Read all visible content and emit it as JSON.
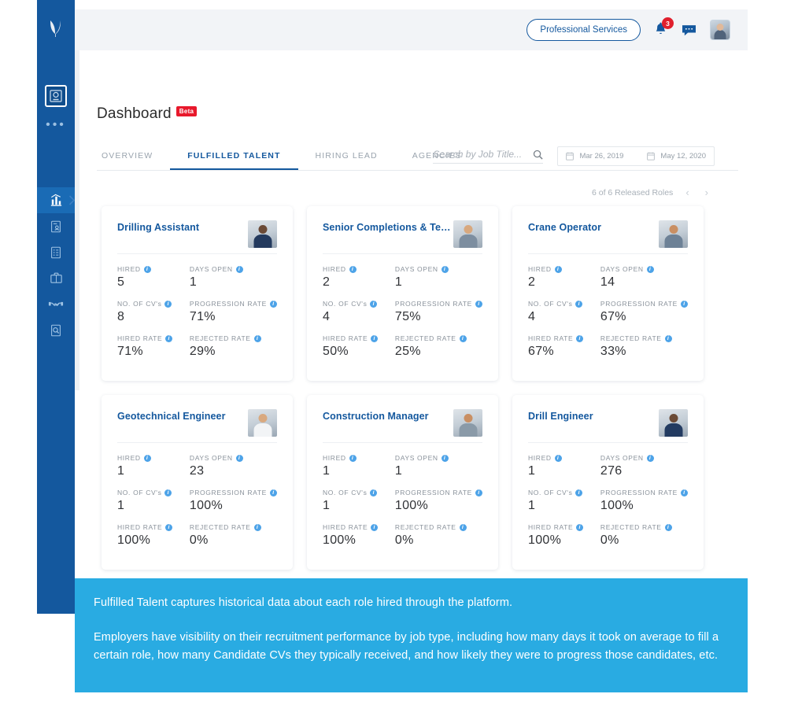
{
  "sidebar": {
    "logo_icon": "leaf-logo-icon",
    "more_dots": "•••",
    "top_item": {
      "name": "badge-app-icon"
    },
    "items": [
      {
        "name": "sidebar-item-analytics",
        "icon": "bar-chart-icon",
        "active": true
      },
      {
        "name": "sidebar-item-candidates",
        "icon": "document-person-icon",
        "active": false
      },
      {
        "name": "sidebar-item-checklist",
        "icon": "checklist-icon",
        "active": false
      },
      {
        "name": "sidebar-item-jobs",
        "icon": "briefcase-icon",
        "active": false
      },
      {
        "name": "sidebar-item-agencies",
        "icon": "handshake-icon",
        "active": false
      },
      {
        "name": "sidebar-item-search-cv",
        "icon": "document-search-icon",
        "active": false
      }
    ],
    "expand_icon": "chevron-right-icon"
  },
  "header": {
    "org_pill": "Professional Services",
    "notification_icon": "bell-icon",
    "notification_count": "3",
    "messages_icon": "chat-icon",
    "avatar_icon": "user-avatar"
  },
  "page": {
    "title": "Dashboard",
    "badge": "Beta"
  },
  "tabs": [
    {
      "label": "OVERVIEW",
      "active": false
    },
    {
      "label": "FULFILLED TALENT",
      "active": true
    },
    {
      "label": "HIRING LEAD",
      "active": false
    },
    {
      "label": "AGENCIES",
      "active": false
    }
  ],
  "search": {
    "placeholder": "Search by Job Title...",
    "value": "",
    "icon": "search-icon"
  },
  "date_range": {
    "start": "Mar 26, 2019",
    "end": "May 12, 2020",
    "icon": "calendar-icon"
  },
  "pagination": {
    "summary": "6 of 6 Released Roles",
    "prev": "‹",
    "next": "›"
  },
  "metric_labels": {
    "hired": "HIRED",
    "days_open": "DAYS OPEN",
    "cvs": "NO. OF CV's",
    "progression_rate": "PROGRESSION RATE",
    "hired_rate": "HIRED RATE",
    "rejected_rate": "REJECTED RATE"
  },
  "cards": [
    {
      "title": "Drilling Assistant",
      "hired": "5",
      "days_open": "1",
      "cvs": "8",
      "progression_rate": "71%",
      "hired_rate": "71%",
      "rejected_rate": "29%",
      "avatar_skin": "#6b4a36",
      "avatar_cloth": "#243a5e"
    },
    {
      "title": "Senior Completions & Test Engin...",
      "hired": "2",
      "days_open": "1",
      "cvs": "4",
      "progression_rate": "75%",
      "hired_rate": "50%",
      "rejected_rate": "25%",
      "avatar_skin": "#d8a87e",
      "avatar_cloth": "#7d8ea0"
    },
    {
      "title": "Crane Operator",
      "hired": "2",
      "days_open": "14",
      "cvs": "4",
      "progression_rate": "67%",
      "hired_rate": "67%",
      "rejected_rate": "33%",
      "avatar_skin": "#c98f63",
      "avatar_cloth": "#6d8196"
    },
    {
      "title": "Geotechnical Engineer",
      "hired": "1",
      "days_open": "23",
      "cvs": "1",
      "progression_rate": "100%",
      "hired_rate": "100%",
      "rejected_rate": "0%",
      "avatar_skin": "#d9a97f",
      "avatar_cloth": "#f2f4f6"
    },
    {
      "title": "Construction Manager",
      "hired": "1",
      "days_open": "1",
      "cvs": "1",
      "progression_rate": "100%",
      "hired_rate": "100%",
      "rejected_rate": "0%",
      "avatar_skin": "#c98f63",
      "avatar_cloth": "#8a9aa8"
    },
    {
      "title": "Drill Engineer",
      "hired": "1",
      "days_open": "276",
      "cvs": "1",
      "progression_rate": "100%",
      "hired_rate": "100%",
      "rejected_rate": "0%",
      "avatar_skin": "#6b4a36",
      "avatar_cloth": "#233b61"
    }
  ],
  "caption": {
    "paragraph1": "Fulfilled Talent captures historical data about each role hired through the platform.",
    "paragraph2": "Employers have visibility on their recruitment performance by job type, including how many days it took on average to fill a certain role, how many Candidate CVs they typically received, and how likely they were to progress those candidates, etc."
  },
  "colors": {
    "sidebar": "#14589e",
    "accent": "#14589e",
    "caption_bg": "#29abe2",
    "badge_red": "#e8192c",
    "info_blue": "#4da3e8"
  }
}
